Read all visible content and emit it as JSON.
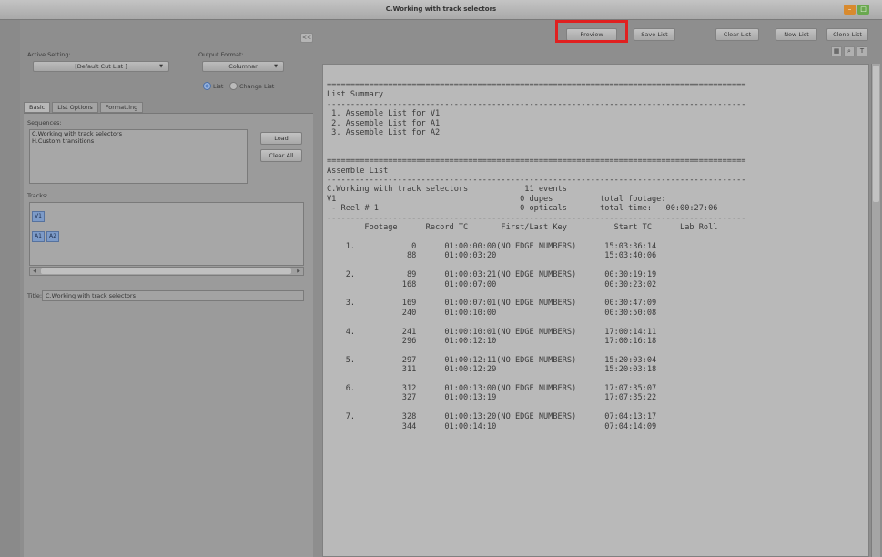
{
  "window": {
    "title": "C.Working with track selectors"
  },
  "collapse_label": "<<",
  "left_panel": {
    "active_setting_label": "Active Setting:",
    "active_setting_value": "[Default Cut List ]",
    "output_format_label": "Output Format:",
    "output_format_value": "Columnar",
    "radio_list": "List",
    "radio_change_list": "Change List",
    "tabs": [
      "Basic",
      "List Options",
      "Formatting"
    ],
    "sequences_label": "Sequences:",
    "sequences": [
      "C.Working with track selectors",
      "H.Custom transitions"
    ],
    "load_button": "Load",
    "clear_all_button": "Clear All",
    "tracks_label": "Tracks:",
    "tracks": [
      "V1",
      "A1",
      "A2"
    ],
    "title_label": "Title:",
    "title_value": "C.Working with track selectors"
  },
  "toolbar": {
    "preview": "Preview",
    "save_list": "Save List",
    "clear_list": "Clear List",
    "new_list": "New List",
    "clone_list": "Clone List"
  },
  "icons": [
    "grid-icon",
    "search-icon",
    "text-icon"
  ],
  "list": {
    "summary_title": "List Summary",
    "summary_items": [
      "1. Assemble List for V1",
      "2. Assemble List for A1",
      "3. Assemble List for A2"
    ],
    "assemble_title": "Assemble List",
    "sequence_name": "C.Working with track selectors",
    "events": "11 events",
    "track": "V1",
    "dupes": "0 dupes",
    "total_footage": "total footage:",
    "reel": "- Reel # 1",
    "opticals": "0 opticals",
    "total_time_label": "total time:",
    "total_time": "00:00:27:06",
    "columns": [
      "Footage",
      "Record TC",
      "First/Last Key",
      "Start TC",
      "Lab Roll"
    ],
    "rows": [
      {
        "n": "1.",
        "f1": "0",
        "f2": "88",
        "tc1": "01:00:00:00",
        "tc2": "01:00:03:20",
        "key": "(NO EDGE NUMBERS)",
        "st1": "15:03:36:14",
        "st2": "15:03:40:06"
      },
      {
        "n": "2.",
        "f1": "89",
        "f2": "168",
        "tc1": "01:00:03:21",
        "tc2": "01:00:07:00",
        "key": "(NO EDGE NUMBERS)",
        "st1": "00:30:19:19",
        "st2": "00:30:23:02"
      },
      {
        "n": "3.",
        "f1": "169",
        "f2": "240",
        "tc1": "01:00:07:01",
        "tc2": "01:00:10:00",
        "key": "(NO EDGE NUMBERS)",
        "st1": "00:30:47:09",
        "st2": "00:30:50:08"
      },
      {
        "n": "4.",
        "f1": "241",
        "f2": "296",
        "tc1": "01:00:10:01",
        "tc2": "01:00:12:10",
        "key": "(NO EDGE NUMBERS)",
        "st1": "17:00:14:11",
        "st2": "17:00:16:18"
      },
      {
        "n": "5.",
        "f1": "297",
        "f2": "311",
        "tc1": "01:00:12:11",
        "tc2": "01:00:12:29",
        "key": "(NO EDGE NUMBERS)",
        "st1": "15:20:03:04",
        "st2": "15:20:03:18"
      },
      {
        "n": "6.",
        "f1": "312",
        "f2": "327",
        "tc1": "01:00:13:00",
        "tc2": "01:00:13:19",
        "key": "(NO EDGE NUMBERS)",
        "st1": "17:07:35:07",
        "st2": "17:07:35:22"
      },
      {
        "n": "7.",
        "f1": "328",
        "f2": "344",
        "tc1": "01:00:13:20",
        "tc2": "01:00:14:10",
        "key": "(NO EDGE NUMBERS)",
        "st1": "07:04:13:17",
        "st2": "07:04:14:09"
      }
    ]
  }
}
